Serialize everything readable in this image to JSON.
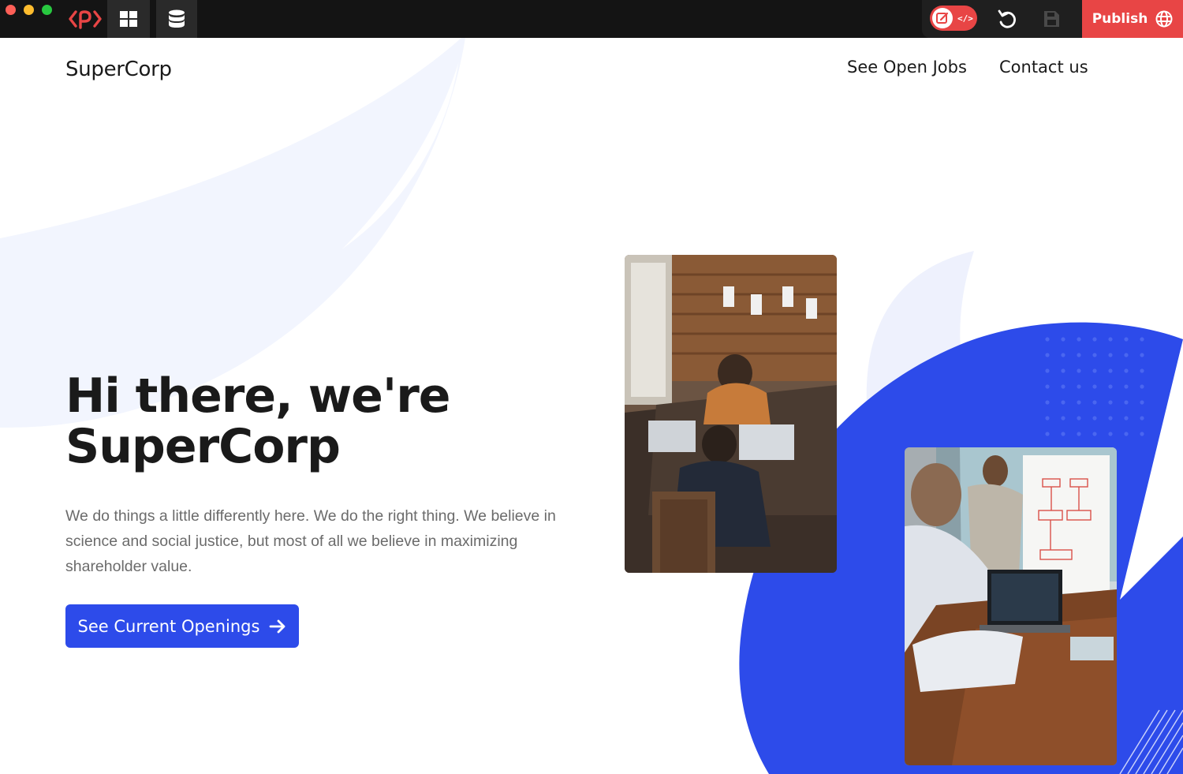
{
  "editor": {
    "publish_label": "Publish",
    "icons": {
      "logo": "code-brackets-logo-icon",
      "layout": "grid-layout-icon",
      "database": "database-icon",
      "edit": "edit-icon",
      "code": "code-icon",
      "undo": "undo-icon",
      "save": "save-icon",
      "globe": "globe-icon"
    },
    "mode_toggle_code_glyph": "</>"
  },
  "site": {
    "brand": "SuperCorp",
    "nav": [
      {
        "label": "See Open Jobs"
      },
      {
        "label": "Contact us"
      }
    ],
    "hero": {
      "title_line1": "Hi there, we're",
      "title_line2": "SuperCorp",
      "subtitle": "We do things a little differently here. We do the right thing. We believe in science and social justice, but most of all we believe in maximizing shareholder value.",
      "cta_label": "See Current Openings",
      "cta_icon": "arrow-right-icon"
    }
  },
  "colors": {
    "accent": "#2d4bea",
    "publish": "#e84545",
    "topbar": "#141414",
    "deco_light": "#f2f5fe"
  }
}
